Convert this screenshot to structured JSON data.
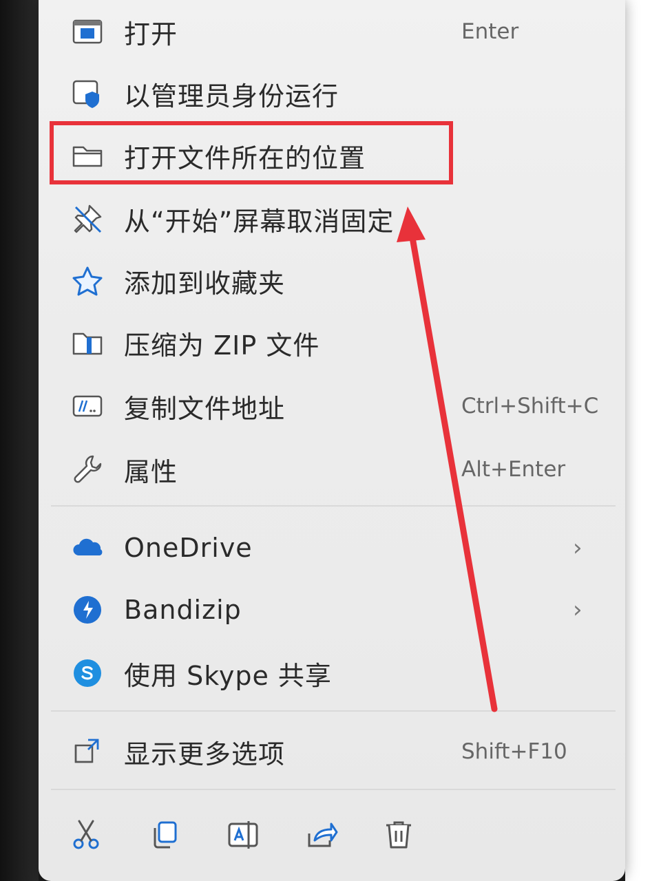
{
  "menu_items": [
    {
      "label": "打开",
      "shortcut": "Enter",
      "icon": "open-window-icon"
    },
    {
      "label": "以管理员身份运行",
      "shortcut": "",
      "icon": "admin-shield-icon"
    },
    {
      "label": "打开文件所在的位置",
      "shortcut": "",
      "icon": "folder-icon"
    },
    {
      "label": "从“开始”屏幕取消固定",
      "shortcut": "",
      "icon": "unpin-icon"
    },
    {
      "label": "添加到收藏夹",
      "shortcut": "",
      "icon": "star-icon"
    },
    {
      "label": "压缩为 ZIP 文件",
      "shortcut": "",
      "icon": "zip-folder-icon"
    },
    {
      "label": "复制文件地址",
      "shortcut": "Ctrl+Shift+C",
      "icon": "copy-path-icon"
    },
    {
      "label": "属性",
      "shortcut": "Alt+Enter",
      "icon": "wrench-icon"
    }
  ],
  "submenu_items": [
    {
      "label": "OneDrive",
      "chevron": "›",
      "icon": "onedrive-cloud-icon"
    },
    {
      "label": "Bandizip",
      "chevron": "›",
      "icon": "bandizip-icon"
    },
    {
      "label": "使用 Skype 共享",
      "chevron": "",
      "icon": "skype-icon"
    }
  ],
  "more_options": {
    "label": "显示更多选项",
    "shortcut": "Shift+F10",
    "icon": "more-options-icon"
  },
  "toolbar": [
    "cut-icon",
    "copy-icon",
    "rename-icon",
    "share-icon",
    "delete-icon"
  ],
  "colors": {
    "accent": "#1f6fd1",
    "highlight": "#e8323a",
    "text": "#2a2a2a"
  }
}
